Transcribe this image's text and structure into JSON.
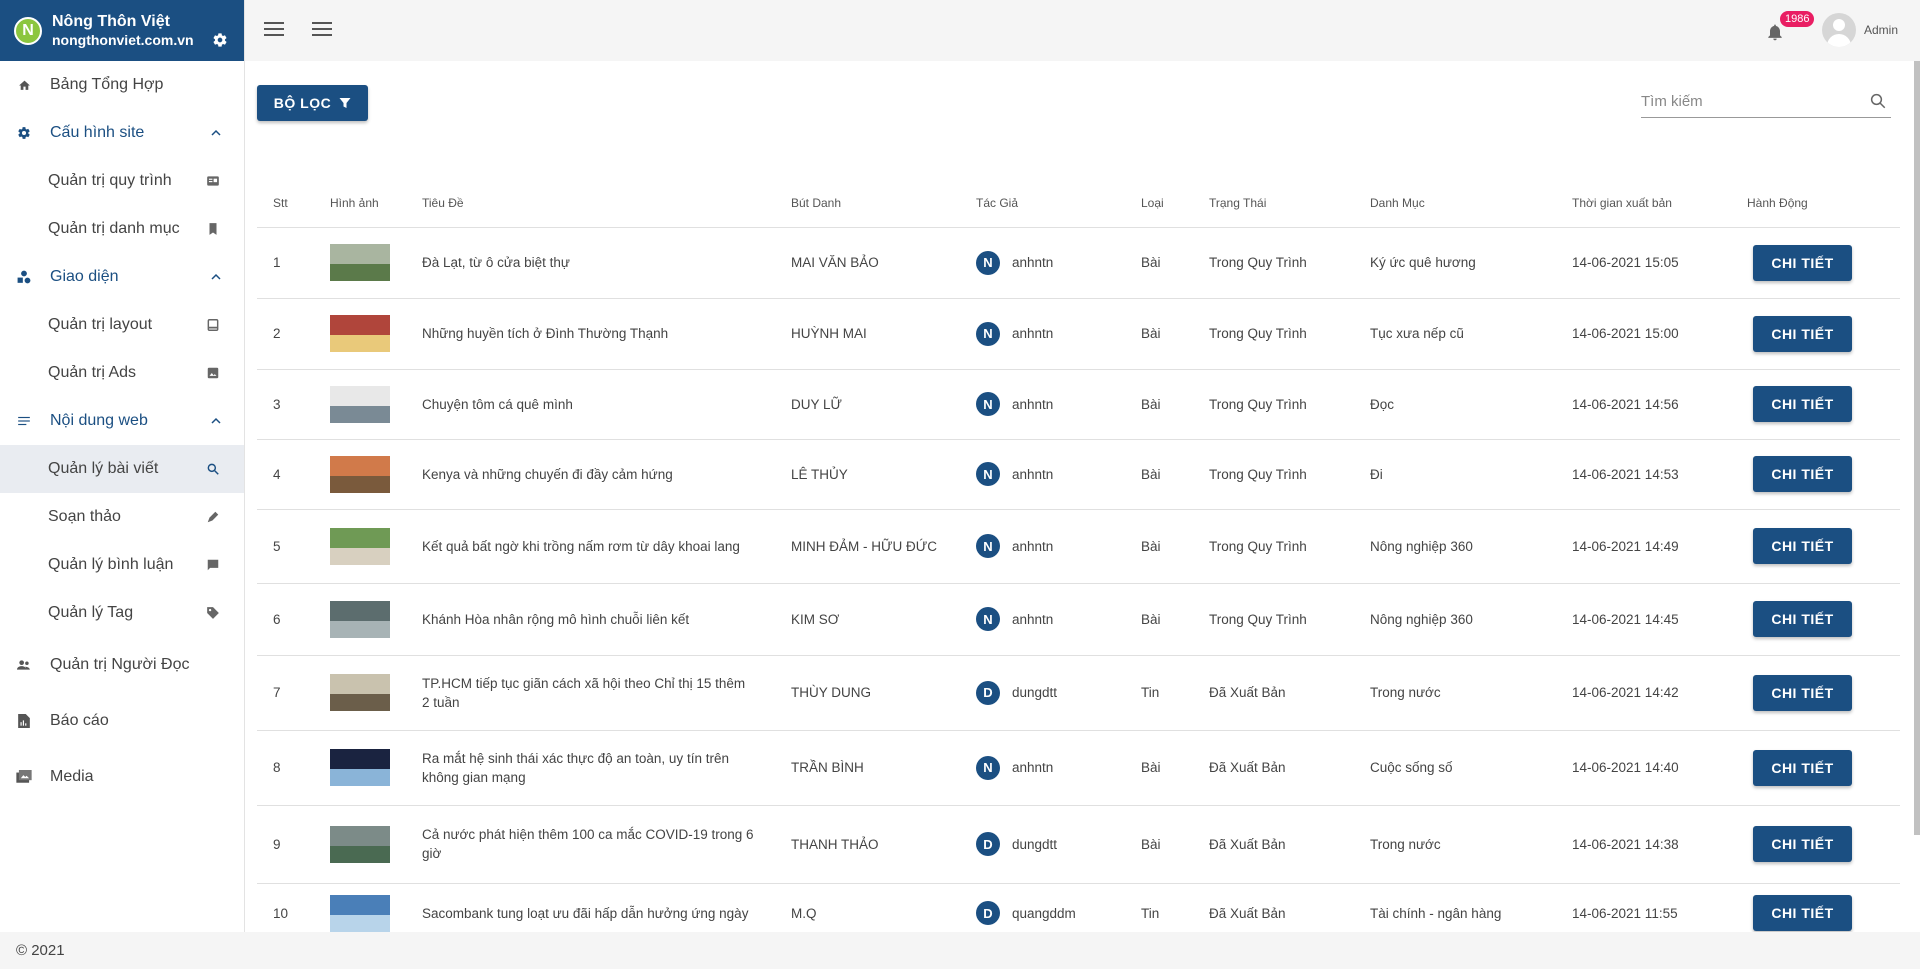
{
  "brand": {
    "name": "Nông Thôn Việt",
    "domain": "nongthonviet.com.vn",
    "logo_letter": "N"
  },
  "sidebar": {
    "items": [
      {
        "label": "Bảng Tổng Hợp",
        "icon": "home-icon"
      },
      {
        "label": "Cấu hình site",
        "icon": "gear-icon",
        "group": true
      },
      {
        "label": "Quản trị quy trình",
        "icon": "workflow-icon"
      },
      {
        "label": "Quản trị danh mục",
        "icon": "bookmark-icon"
      },
      {
        "label": "Giao diện",
        "icon": "shapes-icon",
        "group": true
      },
      {
        "label": "Quản trị layout",
        "icon": "layout-icon"
      },
      {
        "label": "Quản trị Ads",
        "icon": "image-icon"
      },
      {
        "label": "Nội dung web",
        "icon": "list-icon",
        "group": true
      },
      {
        "label": "Quản lý bài viết",
        "icon": "search-icon",
        "active": true
      },
      {
        "label": "Soạn thảo",
        "icon": "pen-icon"
      },
      {
        "label": "Quản lý bình luận",
        "icon": "comment-icon"
      },
      {
        "label": "Quản lý Tag",
        "icon": "tag-icon"
      },
      {
        "label": "Quản trị Người Đọc",
        "icon": "people-icon"
      },
      {
        "label": "Báo cáo",
        "icon": "report-icon"
      },
      {
        "label": "Media",
        "icon": "media-icon"
      }
    ]
  },
  "topbar": {
    "notification_count": "1986",
    "user_name": "Admin"
  },
  "toolbar": {
    "filter_label": "BỘ LỌC",
    "search_placeholder": "Tìm kiếm"
  },
  "table": {
    "headers": [
      "Stt",
      "Hình ảnh",
      "Tiêu Đề",
      "Bút Danh",
      "Tác Giả",
      "Loại",
      "Trạng Thái",
      "Danh Mục",
      "Thời gian xuất bản",
      "Hành Động"
    ],
    "action_label": "CHI TIẾT",
    "rows": [
      {
        "stt": "1",
        "title": "Đà Lạt, từ ô cửa biệt thự",
        "pen": "MAI VĂN BẢO",
        "initial": "N",
        "author": "anhntn",
        "type": "Bài",
        "status": "Trong Quy Trình",
        "category": "Ký ức quê hương",
        "time": "14-06-2021 15:05"
      },
      {
        "stt": "2",
        "title": "Những huyền tích ở Đình Thường Thạnh",
        "pen": "HUỲNH MAI",
        "initial": "N",
        "author": "anhntn",
        "type": "Bài",
        "status": "Trong Quy Trình",
        "category": "Tục xưa nếp cũ",
        "time": "14-06-2021 15:00"
      },
      {
        "stt": "3",
        "title": "Chuyện tôm cá quê mình",
        "pen": "DUY LỮ",
        "initial": "N",
        "author": "anhntn",
        "type": "Bài",
        "status": "Trong Quy Trình",
        "category": "Đọc",
        "time": "14-06-2021 14:56"
      },
      {
        "stt": "4",
        "title": "Kenya và những chuyến đi đầy cảm hứng",
        "pen": "LÊ THỦY",
        "initial": "N",
        "author": "anhntn",
        "type": "Bài",
        "status": "Trong Quy Trình",
        "category": "Đi",
        "time": "14-06-2021 14:53"
      },
      {
        "stt": "5",
        "title": "Kết quả bất ngờ khi trồng nấm rơm từ dây khoai lang",
        "pen": "MINH ĐẢM - HỮU ĐỨC",
        "initial": "N",
        "author": "anhntn",
        "type": "Bài",
        "status": "Trong Quy Trình",
        "category": "Nông nghiệp 360",
        "time": "14-06-2021 14:49"
      },
      {
        "stt": "6",
        "title": "Khánh Hòa nhân rộng mô hình chuỗi liên kết",
        "pen": "KIM SƠ",
        "initial": "N",
        "author": "anhntn",
        "type": "Bài",
        "status": "Trong Quy Trình",
        "category": "Nông nghiệp 360",
        "time": "14-06-2021 14:45"
      },
      {
        "stt": "7",
        "title": "TP.HCM tiếp tục giãn cách xã hội theo Chỉ thị 15 thêm 2 tuần",
        "pen": "THÙY DUNG",
        "initial": "D",
        "author": "dungdtt",
        "type": "Tin",
        "status": "Đã Xuất Bản",
        "category": "Trong nước",
        "time": "14-06-2021 14:42"
      },
      {
        "stt": "8",
        "title": "Ra mắt hệ sinh thái xác thực độ an toàn, uy tín trên không gian mạng",
        "pen": "TRẦN BÌNH",
        "initial": "N",
        "author": "anhntn",
        "type": "Bài",
        "status": "Đã Xuất Bản",
        "category": "Cuộc sống số",
        "time": "14-06-2021 14:40"
      },
      {
        "stt": "9",
        "title": "Cả nước phát hiện thêm 100 ca mắc COVID-19 trong 6 giờ",
        "pen": "THANH THẢO",
        "initial": "D",
        "author": "dungdtt",
        "type": "Bài",
        "status": "Đã Xuất Bản",
        "category": "Trong nước",
        "time": "14-06-2021 14:38"
      },
      {
        "stt": "10",
        "title": "Sacombank tung loạt ưu đãi hấp dẫn hưởng ứng ngày",
        "pen": "M.Q",
        "initial": "D",
        "author": "quangddm",
        "type": "Tin",
        "status": "Đã Xuất Bản",
        "category": "Tài chính - ngân hàng",
        "time": "14-06-2021 11:55"
      }
    ]
  },
  "footer": {
    "copyright": "© 2021"
  },
  "colors": {
    "primary": "#1b4f82",
    "badge": "#e91e63",
    "brand_green": "#8cc63f"
  }
}
